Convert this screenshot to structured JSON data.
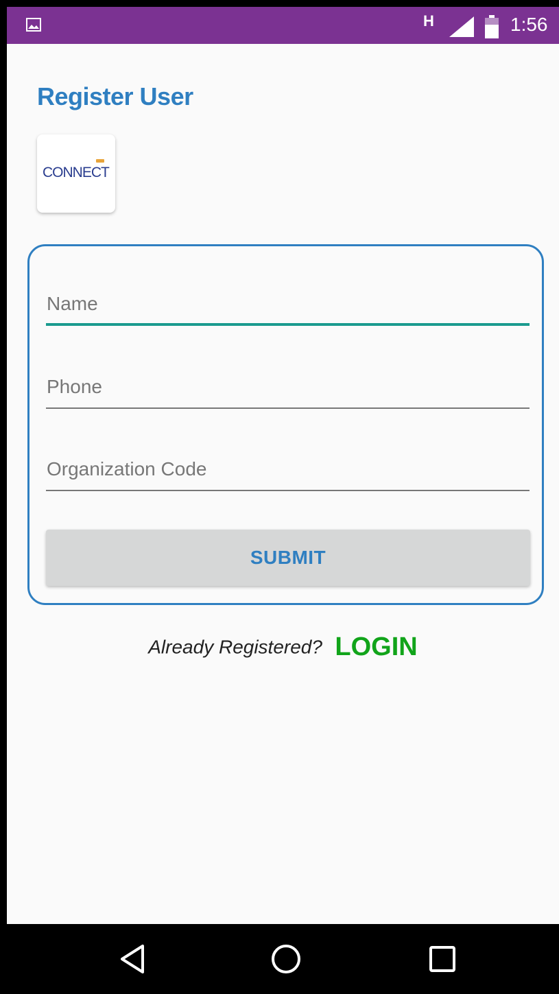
{
  "status_bar": {
    "network_type": "H",
    "time": "1:56",
    "icons": [
      "gallery-icon",
      "signal-icon",
      "battery-icon"
    ]
  },
  "page": {
    "title": "Register User"
  },
  "logo": {
    "text": "CONNECT"
  },
  "form": {
    "name_placeholder": "Name",
    "phone_placeholder": "Phone",
    "org_code_placeholder": "Organization Code",
    "submit_label": "SUBMIT"
  },
  "login": {
    "prompt": "Already Registered?",
    "link_label": "LOGIN"
  },
  "nav_bar": {
    "icons": [
      "back-icon",
      "home-icon",
      "recents-icon"
    ]
  },
  "colors": {
    "status_bar": "#7b3292",
    "title": "#2f7fc1",
    "focus_underline": "#1a9a8e",
    "login_link": "#11a41a"
  }
}
